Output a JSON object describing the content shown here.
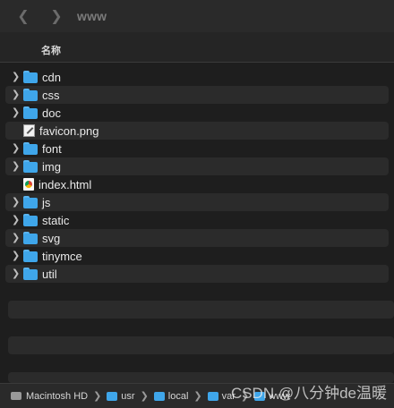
{
  "window": {
    "title": "www"
  },
  "header": {
    "name_col": "名称"
  },
  "items": [
    {
      "name": "cdn",
      "type": "folder"
    },
    {
      "name": "css",
      "type": "folder"
    },
    {
      "name": "doc",
      "type": "folder"
    },
    {
      "name": "favicon.png",
      "type": "image"
    },
    {
      "name": "font",
      "type": "folder"
    },
    {
      "name": "img",
      "type": "folder"
    },
    {
      "name": "index.html",
      "type": "html"
    },
    {
      "name": "js",
      "type": "folder"
    },
    {
      "name": "static",
      "type": "folder"
    },
    {
      "name": "svg",
      "type": "folder"
    },
    {
      "name": "tinymce",
      "type": "folder"
    },
    {
      "name": "util",
      "type": "folder"
    }
  ],
  "pathbar": [
    "Macintosh HD",
    "usr",
    "local",
    "var",
    "www"
  ],
  "watermark": "CSDN @八分钟de温暖",
  "colors": {
    "background": "#1e1e1e",
    "folder": "#3fa6ea",
    "alt_row": "#2b2b2b"
  }
}
